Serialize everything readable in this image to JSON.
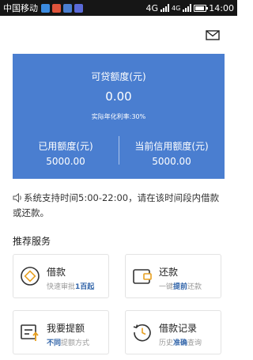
{
  "statusbar": {
    "carrier": "中国移动",
    "network": "4G",
    "network2": "4G",
    "time": "14:00"
  },
  "header": {
    "title": "",
    "mail_icon": "mail-icon"
  },
  "credit_card": {
    "available_label": "可贷额度(元)",
    "available_amount": "0.00",
    "annual_rate": "实际年化利率:30%",
    "used_label": "已用额度(元)",
    "used_amount": "5000.00",
    "current_label": "当前信用额度(元)",
    "current_amount": "5000.00",
    "color": "#4a7ed0"
  },
  "notice": {
    "text": "系统支持时间5:00-22:00，请在该时间段内借款或还款。"
  },
  "services": {
    "title": "推荐服务",
    "items": [
      {
        "title": "借款",
        "subtitle_pre": "快速审批",
        "subtitle_hl": "1百起",
        "subtitle_post": "",
        "icon": "loan-icon"
      },
      {
        "title": "还款",
        "subtitle_pre": "一键",
        "subtitle_hl": "提前",
        "subtitle_post": "还款",
        "icon": "wallet-icon"
      },
      {
        "title": "我要提额",
        "subtitle_pre": "",
        "subtitle_hl": "不同",
        "subtitle_post": "提额方式",
        "icon": "raise-limit-icon"
      },
      {
        "title": "借款记录",
        "subtitle_pre": "历史",
        "subtitle_hl": "准确",
        "subtitle_post": "查询",
        "icon": "history-icon"
      }
    ]
  }
}
